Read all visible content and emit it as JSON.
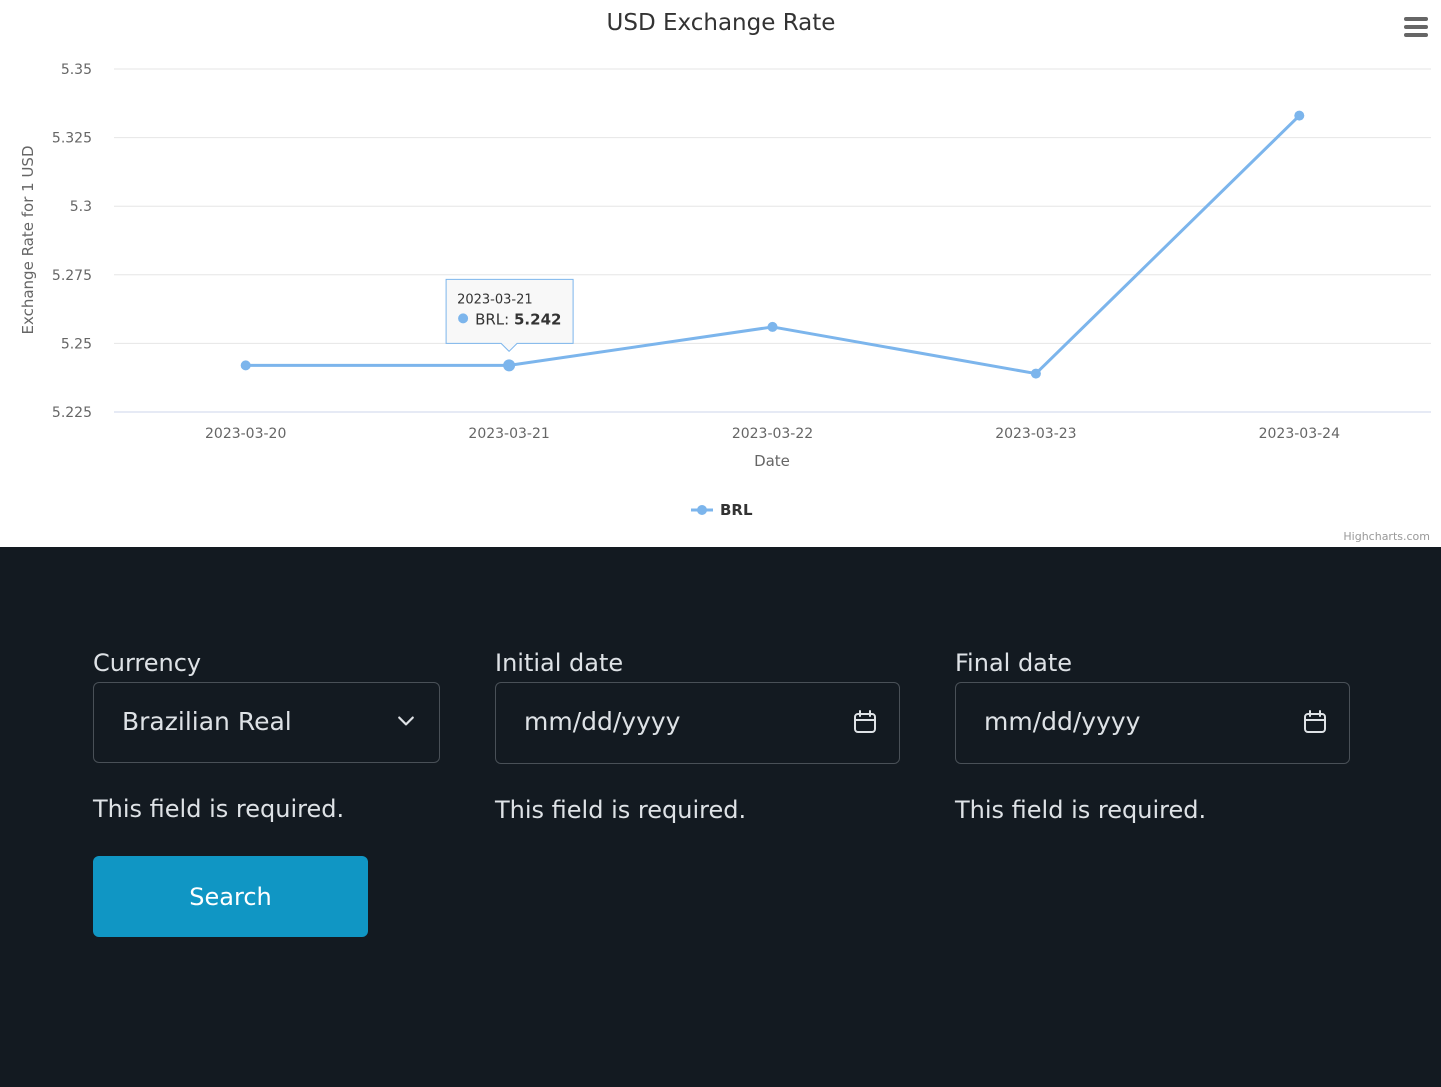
{
  "chart_data": {
    "type": "line",
    "title": "USD Exchange Rate",
    "xlabel": "Date",
    "ylabel": "Exchange Rate for 1 USD",
    "categories": [
      "2023-03-20",
      "2023-03-21",
      "2023-03-22",
      "2023-03-23",
      "2023-03-24"
    ],
    "series": [
      {
        "name": "BRL",
        "values": [
          5.242,
          5.242,
          5.256,
          5.239,
          5.333
        ],
        "color": "#7cb5ec"
      }
    ],
    "yticks": [
      "5.35",
      "5.325",
      "5.3",
      "5.275",
      "5.25",
      "5.225"
    ],
    "ylim": [
      5.225,
      5.35
    ],
    "grid": true,
    "legend_position": "bottom-center",
    "tooltip": {
      "date": "2023-03-21",
      "series": "BRL",
      "value": "5.242"
    },
    "credits": "Highcharts.com"
  },
  "chart_menu": {
    "icon": "hamburger-menu-icon"
  },
  "form": {
    "currency": {
      "label": "Currency",
      "value": "Brazilian Real",
      "error": "This field is required."
    },
    "initial_date": {
      "label": "Initial date",
      "placeholder": "mm/dd/yyyy",
      "error": "This field is required."
    },
    "final_date": {
      "label": "Final date",
      "placeholder": "mm/dd/yyyy",
      "error": "This field is required."
    },
    "search_label": "Search"
  }
}
